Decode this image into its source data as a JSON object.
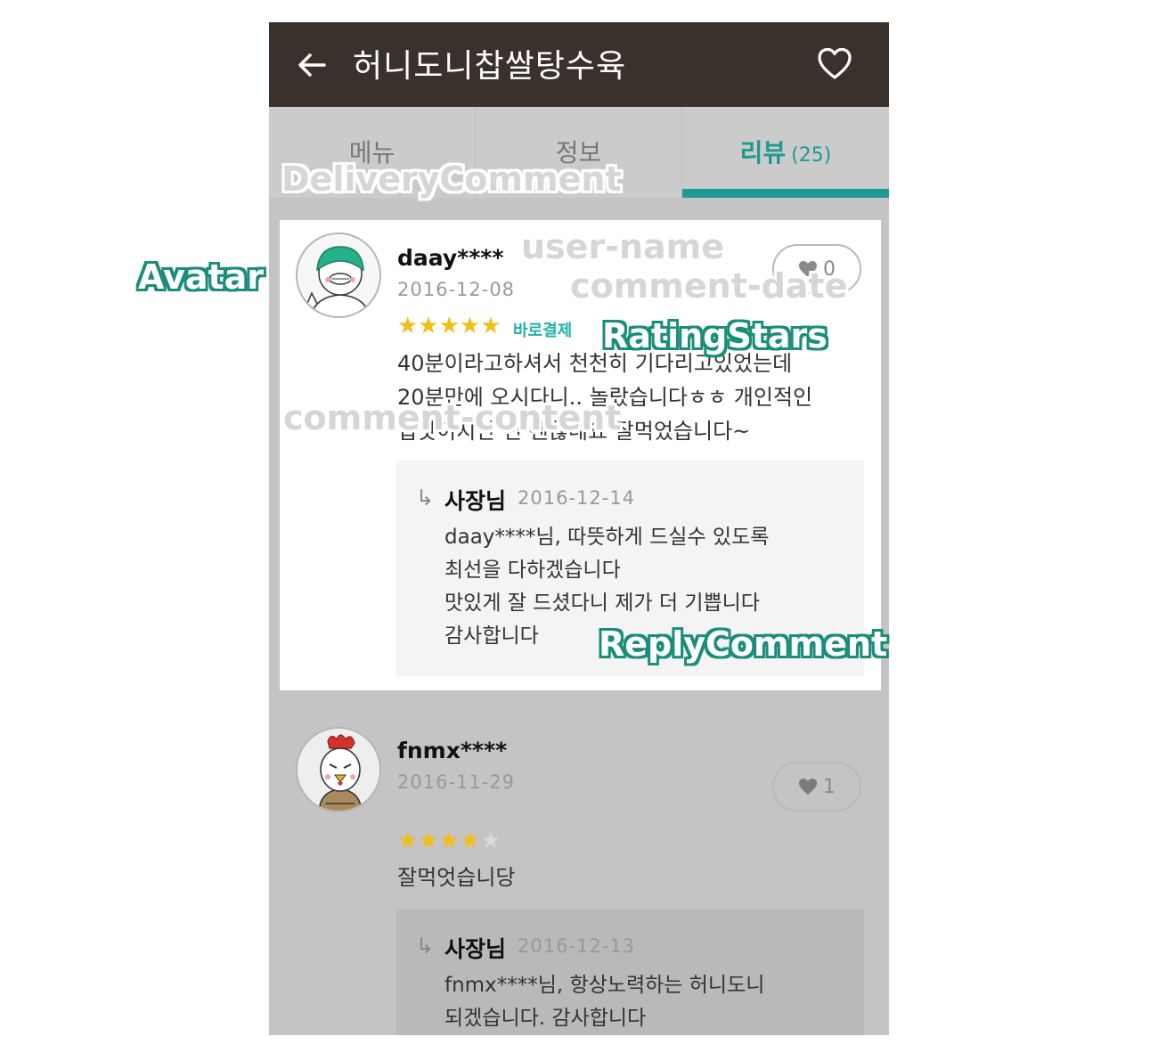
{
  "header": {
    "title": "허니도니찹쌀탕수육",
    "back_icon": "arrow-left-icon",
    "favorite_icon": "heart-outline-icon"
  },
  "tabs": [
    {
      "label": "메뉴"
    },
    {
      "label": "정보"
    },
    {
      "label": "리뷰",
      "count": "(25)",
      "active": true
    }
  ],
  "reviews": [
    {
      "user": "daay****",
      "date": "2016-12-08",
      "likes": "0",
      "rating": 5,
      "stars": "★★★★★",
      "badge": "바로결제",
      "content": [
        "40분이라고하셔서 천천히 기다리고있었는데",
        "20분만에 오시다니.. 놀랐습니다ㅎㅎ 개인적인",
        "입맛이지만 전 괜찮네요 잘먹었습니다~"
      ],
      "reply": {
        "arrow": "↳",
        "name": "사장님",
        "date": "2016-12-14",
        "lines": [
          "daay****님, 따뜻하게 드실수 있도록",
          "최선을 다하겠습니다",
          "맛있게 잘 드셨다니 제가 더 기쁩니다",
          "감사합니다"
        ]
      }
    },
    {
      "user": "fnmx****",
      "date": "2016-11-29",
      "likes": "1",
      "rating": 4,
      "stars_on": "★★★★",
      "stars_off": "★",
      "content": [
        "잘먹엇습니당"
      ],
      "reply": {
        "arrow": "↳",
        "name": "사장님",
        "date": "2016-12-13",
        "lines": [
          "fnmx****님, 항상노력하는 허니도니",
          "되겠습니다. 감사합니다"
        ]
      }
    }
  ],
  "annotations": {
    "delivery_comment": "DeliveryComment",
    "avatar": "Avatar",
    "user_name": "user-name",
    "comment_date": "comment-date",
    "rating_stars": "RatingStars",
    "comment_content": "comment-content",
    "reply_comment": "ReplyComment"
  },
  "colors": {
    "topbar": "#3a312d",
    "accent": "#1d9a91",
    "star": "#f2bf18",
    "annotation_green": "#1b8e7a"
  }
}
